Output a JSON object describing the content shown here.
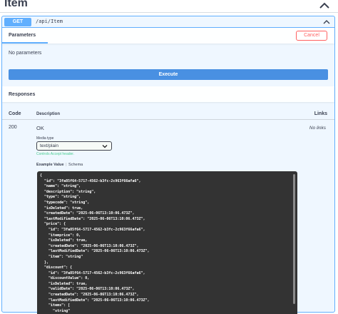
{
  "header": {
    "title": "Item",
    "chevron_icon": "chevron-up-icon"
  },
  "operation": {
    "method": "GET",
    "path": "/api/Item",
    "collapse_icon": "chevron-up-icon"
  },
  "parameters": {
    "tab_label": "Parameters",
    "cancel_label": "Cancel",
    "empty_text": "No parameters"
  },
  "execute_label": "Execute",
  "responses": {
    "title": "Responses",
    "columns": {
      "code": "Code",
      "description": "Description",
      "links": "Links"
    },
    "row": {
      "code": "200",
      "description": "OK",
      "links": "No links",
      "media_type_label": "Media type",
      "media_type_value": "text/plain",
      "controls_note": "Controls Accept header.",
      "tab_example": "Example Value",
      "tab_separator": "|",
      "tab_schema": "Schema",
      "example_json": "{\n  \"id\": \"3fa85f64-5717-4562-b3fc-2c963f66afa6\",\n  \"name\": \"string\",\n  \"description\": \"string\",\n  \"type\": \"string\",\n  \"typecode\": \"string\",\n  \"isDeleted\": true,\n  \"createdDate\": \"2025-06-06T13:10:06.473Z\",\n  \"lastModifiedDate\": \"2025-06-06T13:10:06.473Z\",\n  \"price\": {\n    \"id\": \"3fa85f64-5717-4562-b3fc-2c963f66afa6\",\n    \"itemprice\": 0,\n    \"isDeleted\": true,\n    \"createdDate\": \"2025-06-06T13:10:06.473Z\",\n    \"lastModifiedDate\": \"2025-06-06T13:10:06.473Z\",\n    \"item\": \"string\"\n  },\n  \"discount\": {\n    \"id\": \"3fa85f64-5717-4562-b3fc-2c963f66afa6\",\n    \"discountValue\": 0,\n    \"isDeleted\": true,\n    \"validDate\": \"2025-06-06T13:10:06.473Z\",\n    \"createdDate\": \"2025-06-06T13:10:06.473Z\",\n    \"lastModifiedDate\": \"2025-06-06T13:10:06.473Z\",\n    \"items\": [\n      \"string\"\n    ]"
    }
  },
  "colors": {
    "get_blue": "#61affe",
    "execute_blue": "#4990e2",
    "cancel_red": "#ff6060",
    "code_bg": "#333333",
    "note_green": "#49cc90"
  }
}
